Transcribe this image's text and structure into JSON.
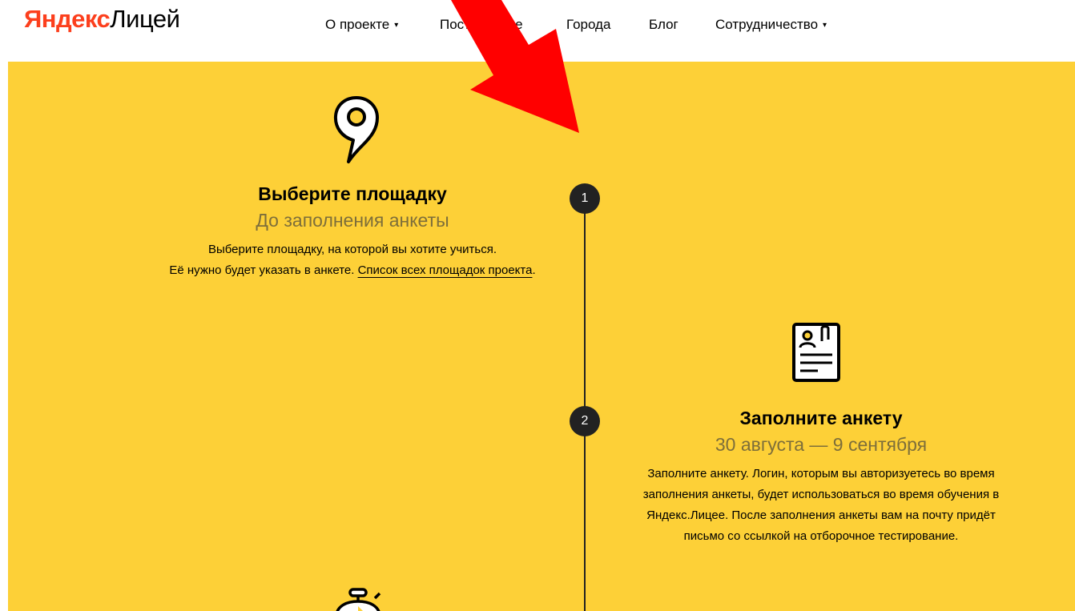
{
  "header": {
    "logo": {
      "brand": "Яндекс",
      "product": "Лицей"
    },
    "nav": [
      {
        "label": "О проекте",
        "has_dropdown": true
      },
      {
        "label": "Поступление",
        "has_dropdown": false
      },
      {
        "label": "Города",
        "has_dropdown": false
      },
      {
        "label": "Блог",
        "has_dropdown": false
      },
      {
        "label": "Сотрудничество",
        "has_dropdown": true
      }
    ],
    "dropdown_caret": "▾"
  },
  "timeline": {
    "steps": [
      {
        "number": "1",
        "icon": "map-pin-icon",
        "title": "Выберите площадку",
        "date": "До заполнения анкеты",
        "text_line1": "Выберите площадку, на которой вы хотите учиться.",
        "text_line2": "Её нужно будет указать в анкете. ",
        "link": "Список всех площадок проекта",
        "text_after_link": "."
      },
      {
        "number": "2",
        "icon": "application-form-icon",
        "title": "Заполните анкету",
        "date": "30 августа — 9 сентября",
        "text": "Заполните анкету. Логин, которым вы авторизуетесь во время заполнения анкеты, будет использоваться во время обучения в Яндекс.Лицее. После заполнения анкеты вам на почту придёт письмо со ссылкой на отборочное тестирование."
      },
      {
        "icon": "stopwatch-icon"
      }
    ]
  },
  "annotation": {
    "icon": "red-arrow-icon",
    "color": "#ff0000"
  },
  "colors": {
    "hero_bg": "#fdd037",
    "brand_red": "#fc3f1d",
    "dark": "#222222"
  }
}
